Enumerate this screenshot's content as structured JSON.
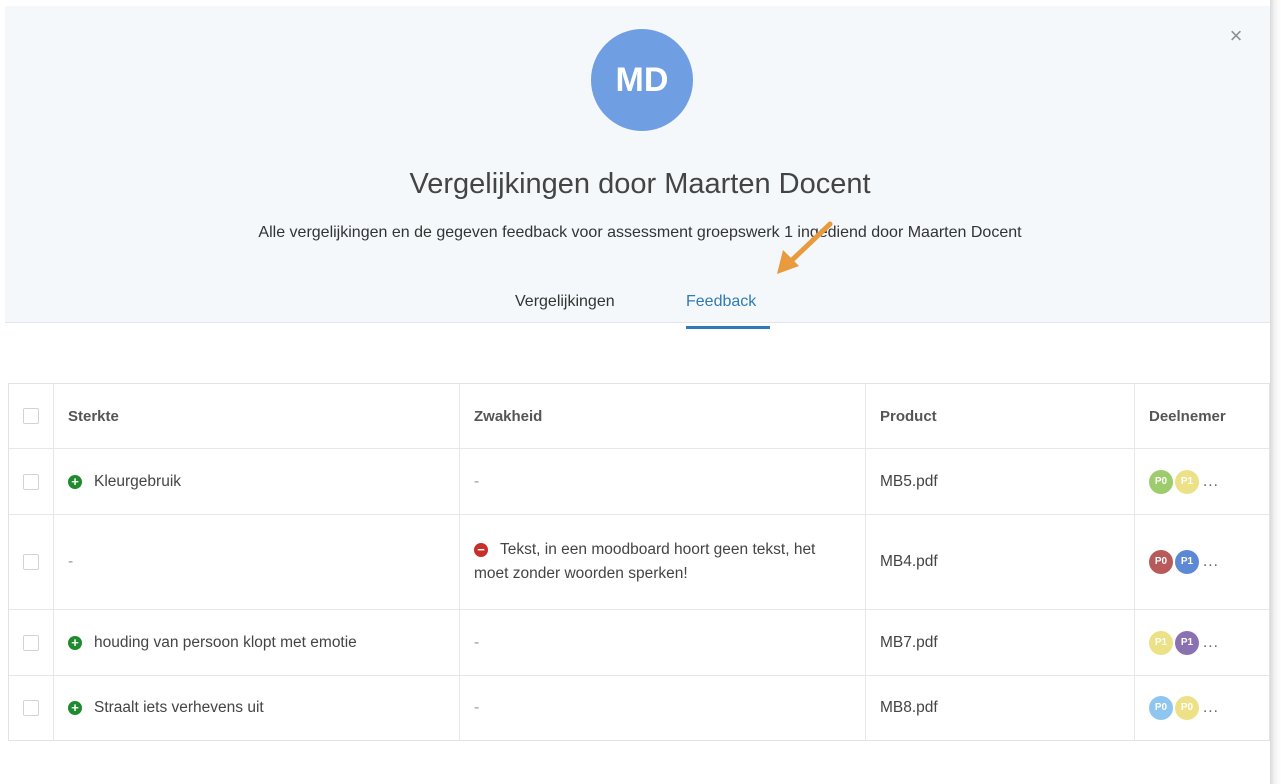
{
  "dialog": {
    "close_glyph": "×",
    "avatar_initials": "MD",
    "avatar_color": "#6f9ee2",
    "title": "Vergelijkingen door Maarten Docent",
    "subtitle": "Alle vergelijkingen en de gegeven feedback voor assessment groepswerk 1 ingediend door Maarten Docent",
    "tabs": [
      {
        "label": "Vergelijkingen",
        "active": false
      },
      {
        "label": "Feedback",
        "active": true
      }
    ],
    "accent_color": "#2f7ab8",
    "annotation": "orange-arrow"
  },
  "table": {
    "headers": [
      "Sterkte",
      "Zwakheid",
      "Product",
      "Deelnemer"
    ],
    "rows": [
      {
        "strength": "Kleurgebruik",
        "weakness": "-",
        "product": "MB5.pdf",
        "participants": [
          {
            "label": "P0",
            "color": "#9ccc6b"
          },
          {
            "label": "P1",
            "color": "#ece186"
          }
        ],
        "more": "..."
      },
      {
        "strength": "-",
        "weakness": "Tekst, in een moodboard hoort geen tekst, het moet zonder woorden sperken!",
        "product": "MB4.pdf",
        "participants": [
          {
            "label": "P0",
            "color": "#b8595b"
          },
          {
            "label": "P1",
            "color": "#5d88d6"
          }
        ],
        "more": "..."
      },
      {
        "strength": "houding van persoon klopt met emotie",
        "weakness": "-",
        "product": "MB7.pdf",
        "participants": [
          {
            "label": "P1",
            "color": "#ece186"
          },
          {
            "label": "P1",
            "color": "#8a72b2"
          }
        ],
        "more": "..."
      },
      {
        "strength": "Straalt iets verhevens uit",
        "weakness": "-",
        "product": "MB8.pdf",
        "participants": [
          {
            "label": "P0",
            "color": "#8fc6ef"
          },
          {
            "label": "P0",
            "color": "#ece186"
          }
        ],
        "more": "..."
      }
    ]
  }
}
